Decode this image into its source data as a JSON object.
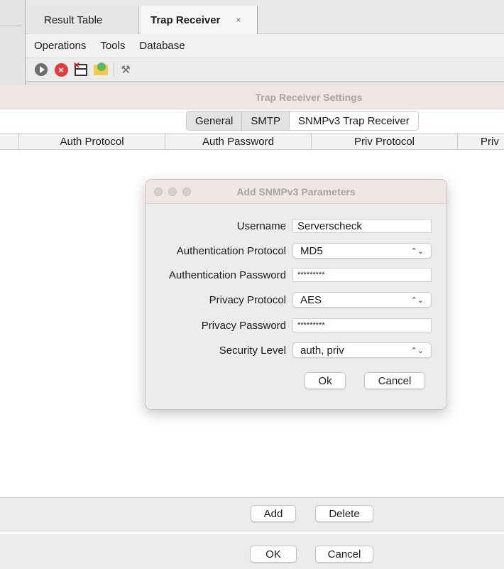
{
  "tabs": [
    {
      "label": "Result Table",
      "active": false
    },
    {
      "label": "Trap Receiver",
      "active": true,
      "close_glyph": "×"
    }
  ],
  "menu": [
    "Operations",
    "Tools",
    "Database"
  ],
  "toolbar": {
    "icons": [
      "play-icon",
      "stop-icon",
      "table-icon",
      "folder-icon",
      "tools-icon"
    ]
  },
  "settings": {
    "title": "Trap Receiver Settings",
    "tabs": [
      {
        "label": "General",
        "active": false
      },
      {
        "label": "SMTP",
        "active": false
      },
      {
        "label": "SNMPv3 Trap Receiver",
        "active": true
      }
    ],
    "columns": [
      "Auth Protocol",
      "Auth Password",
      "Priv Protocol",
      "Priv"
    ]
  },
  "dialog": {
    "title": "Add SNMPv3 Parameters",
    "fields": {
      "username": {
        "label": "Username",
        "value": "Serverscheck"
      },
      "auth_protocol": {
        "label": "Authentication Protocol",
        "value": "MD5"
      },
      "auth_password": {
        "label": "Authentication Password",
        "value": "*********"
      },
      "priv_protocol": {
        "label": "Privacy Protocol",
        "value": "AES"
      },
      "priv_password": {
        "label": "Privacy Password",
        "value": "*********"
      },
      "security_level": {
        "label": "Security Level",
        "value": "auth, priv"
      }
    },
    "ok_label": "Ok",
    "cancel_label": "Cancel"
  },
  "bottom": {
    "add_label": "Add",
    "delete_label": "Delete",
    "ok_label": "OK",
    "cancel_label": "Cancel"
  },
  "colors": {
    "titlebar_tint": "#f1e6e6",
    "stop_red": "#e23b3b",
    "window_bg": "#ececec"
  }
}
